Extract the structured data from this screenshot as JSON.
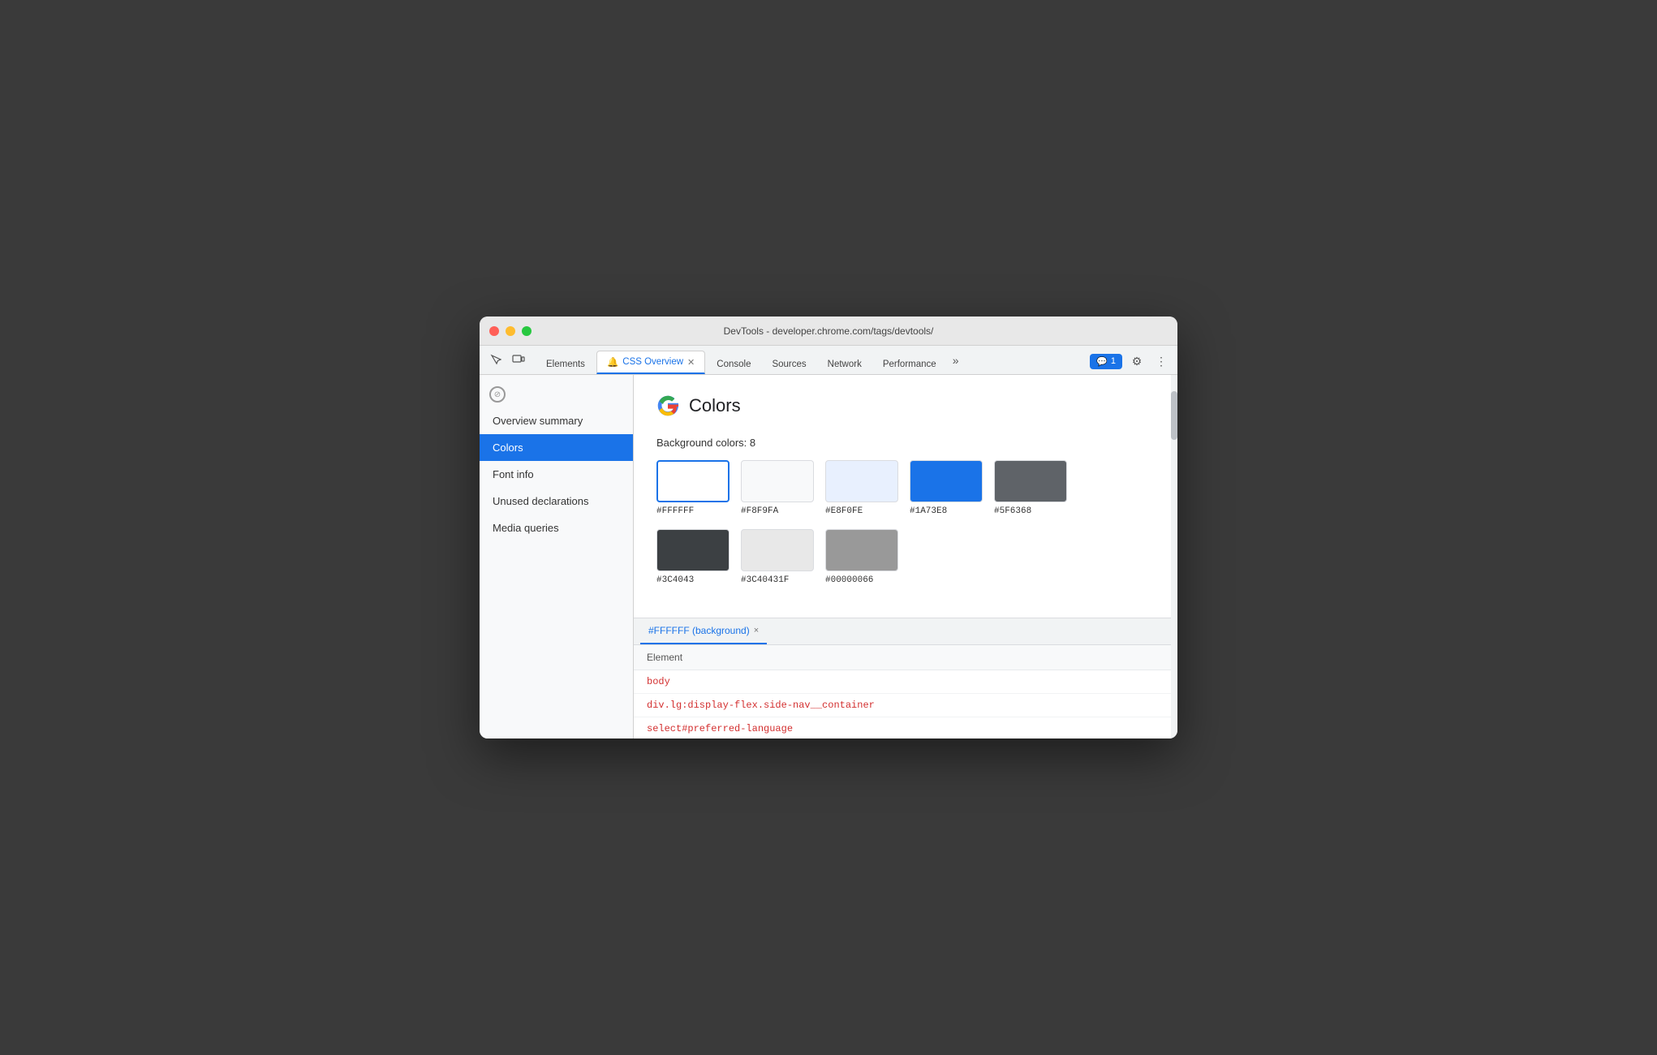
{
  "window": {
    "title": "DevTools - developer.chrome.com/tags/devtools/"
  },
  "tabs": {
    "items": [
      {
        "label": "Elements",
        "active": false,
        "closable": false,
        "id": "elements"
      },
      {
        "label": "CSS Overview",
        "active": true,
        "closable": true,
        "bell": true,
        "id": "css-overview"
      },
      {
        "label": "Console",
        "active": false,
        "closable": false,
        "id": "console"
      },
      {
        "label": "Sources",
        "active": false,
        "closable": false,
        "id": "sources"
      },
      {
        "label": "Network",
        "active": false,
        "closable": false,
        "id": "network"
      },
      {
        "label": "Performance",
        "active": false,
        "closable": false,
        "id": "performance"
      }
    ],
    "more_label": "»",
    "feedback_label": "1",
    "feedback_icon": "💬"
  },
  "sidebar": {
    "items": [
      {
        "label": "Overview summary",
        "active": false,
        "id": "overview-summary"
      },
      {
        "label": "Colors",
        "active": true,
        "id": "colors"
      },
      {
        "label": "Font info",
        "active": false,
        "id": "font-info"
      },
      {
        "label": "Unused declarations",
        "active": false,
        "id": "unused-declarations"
      },
      {
        "label": "Media queries",
        "active": false,
        "id": "media-queries"
      }
    ]
  },
  "panel": {
    "title": "Colors",
    "section_label": "Background colors: 8",
    "colors_row1": [
      {
        "hex": "#FFFFFF",
        "bg": "#FFFFFF",
        "selected": true
      },
      {
        "hex": "#F8F9FA",
        "bg": "#F8F9FA",
        "selected": false
      },
      {
        "hex": "#E8F0FE",
        "bg": "#E8F0FE",
        "selected": false
      },
      {
        "hex": "#1A73E8",
        "bg": "#1A73E8",
        "selected": false
      },
      {
        "hex": "#5F6368",
        "bg": "#5F6368",
        "selected": false
      }
    ],
    "colors_row2": [
      {
        "hex": "#3C4043",
        "bg": "#3C4043",
        "selected": false
      },
      {
        "hex": "#3C40431F",
        "bg": "#e0e0e0",
        "selected": false
      },
      {
        "hex": "#00000066",
        "bg": "rgba(0,0,0,0.4)",
        "selected": false
      }
    ]
  },
  "bottom_panel": {
    "tab_label": "#FFFFFF (background)",
    "tab_close": "×",
    "table_header": "Element",
    "rows": [
      {
        "text": "body",
        "color": "#d32f2f"
      },
      {
        "text": "div.lg:display-flex.side-nav__container",
        "color": "#d32f2f"
      },
      {
        "text": "select#preferred-language",
        "color": "#d32f2f"
      }
    ]
  }
}
